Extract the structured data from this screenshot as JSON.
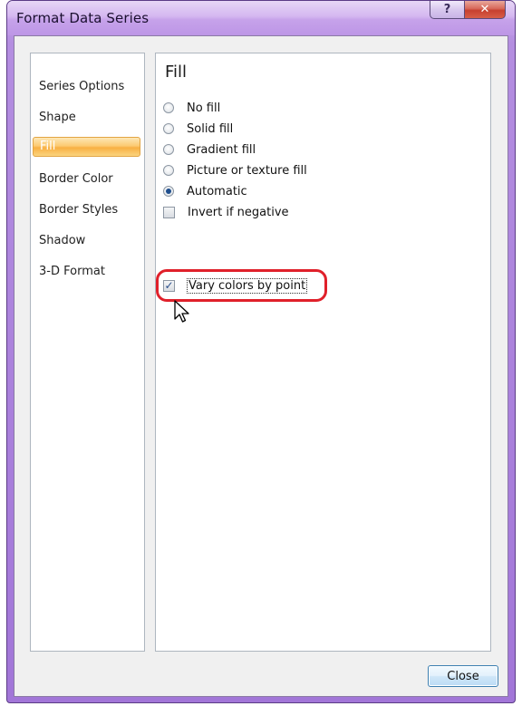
{
  "window": {
    "title": "Format Data Series",
    "help_glyph": "?",
    "close_glyph": "✕"
  },
  "nav": {
    "items": [
      {
        "label": "Series Options",
        "selected": false
      },
      {
        "label": "Shape",
        "selected": false
      },
      {
        "label": "Fill",
        "selected": true
      },
      {
        "label": "Border Color",
        "selected": false
      },
      {
        "label": "Border Styles",
        "selected": false
      },
      {
        "label": "Shadow",
        "selected": false
      },
      {
        "label": "3-D Format",
        "selected": false
      }
    ]
  },
  "fill": {
    "heading": "Fill",
    "options": [
      {
        "label": "No fill",
        "checked": false
      },
      {
        "label": "Solid fill",
        "checked": false
      },
      {
        "label": "Gradient fill",
        "checked": false
      },
      {
        "label": "Picture or texture fill",
        "checked": false
      },
      {
        "label": "Automatic",
        "checked": true
      }
    ],
    "invert_if_negative": {
      "label": "Invert if negative",
      "checked": false
    },
    "vary_colors_by_point": {
      "label": "Vary colors by point",
      "checked": true,
      "check_glyph": "✓"
    }
  },
  "footer": {
    "close_label": "Close"
  },
  "colors": {
    "highlight_ring": "#e0202a",
    "selected_nav": "#f8b043"
  }
}
